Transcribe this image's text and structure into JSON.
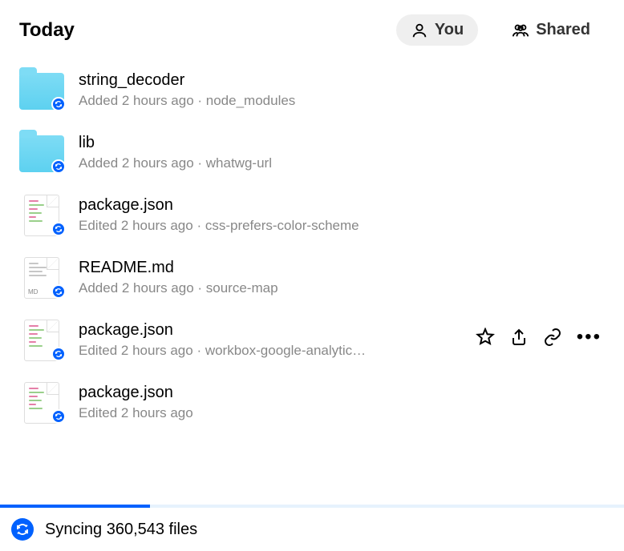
{
  "header": {
    "title": "Today",
    "tabs": {
      "you": "You",
      "shared": "Shared"
    }
  },
  "items": [
    {
      "name": "string_decoder",
      "action": "Added",
      "time": "2 hours ago",
      "location": "node_modules",
      "type": "folder"
    },
    {
      "name": "lib",
      "action": "Added",
      "time": "2 hours ago",
      "location": "whatwg-url",
      "type": "folder"
    },
    {
      "name": "package.json",
      "action": "Edited",
      "time": "2 hours ago",
      "location": "css-prefers-color-scheme",
      "type": "json"
    },
    {
      "name": "README.md",
      "action": "Added",
      "time": "2 hours ago",
      "location": "source-map",
      "type": "md"
    },
    {
      "name": "package.json",
      "action": "Edited",
      "time": "2 hours ago",
      "location": "workbox-google-analytic…",
      "type": "json",
      "hover": true
    },
    {
      "name": "package.json",
      "action": "Edited",
      "time": "2 hours ago",
      "location": "",
      "type": "json"
    }
  ],
  "status": {
    "text": "Syncing 360,543 files"
  },
  "md_ext": "MD",
  "meta_sep": " · "
}
